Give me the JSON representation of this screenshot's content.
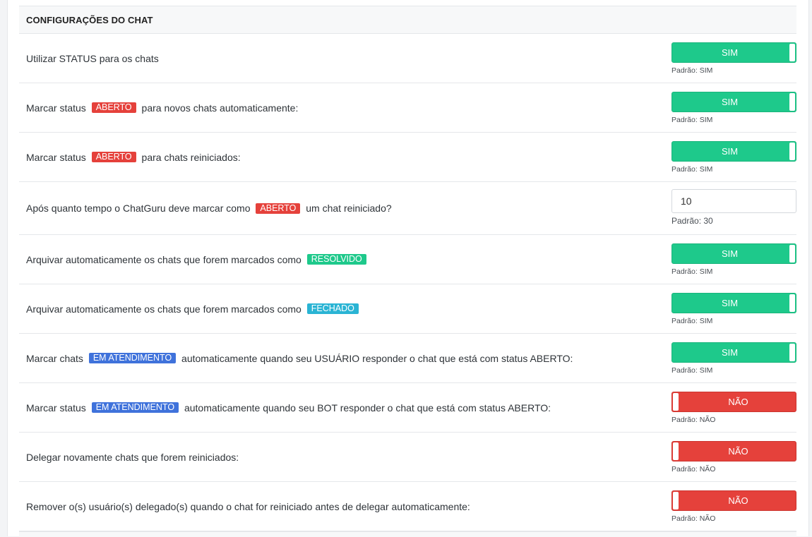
{
  "section": {
    "title": "CONFIGURAÇÕES DO CHAT"
  },
  "colors": {
    "on": "#1ec98b",
    "off": "#e5413b",
    "badge_red": "#e5413b",
    "badge_green": "#1ec98b",
    "badge_cyan": "#2ab4d4",
    "badge_blue": "#3f72db"
  },
  "rows": [
    {
      "parts": [
        "Utilizar STATUS para os chats"
      ],
      "control": {
        "type": "toggle",
        "state": "on",
        "label": "SIM",
        "default": "Padrão: SIM"
      }
    },
    {
      "parts": [
        "Marcar status ",
        "ABERTO",
        " para novos chats automaticamente:"
      ],
      "badge": {
        "text": "ABERTO",
        "color": "red"
      },
      "control": {
        "type": "toggle",
        "state": "on",
        "label": "SIM",
        "default": "Padrão: SIM"
      }
    },
    {
      "parts": [
        "Marcar status ",
        "ABERTO",
        " para chats reiniciados:"
      ],
      "badge": {
        "text": "ABERTO",
        "color": "red"
      },
      "control": {
        "type": "toggle",
        "state": "on",
        "label": "SIM",
        "default": "Padrão: SIM"
      }
    },
    {
      "parts": [
        "Após quanto tempo o ChatGuru deve marcar como ",
        "ABERTO",
        " um chat reiniciado?"
      ],
      "badge": {
        "text": "ABERTO",
        "color": "red"
      },
      "control": {
        "type": "input",
        "value": "10",
        "default": "Padrão: 30"
      }
    },
    {
      "parts": [
        "Arquivar automaticamente os chats que forem marcados como ",
        "RESOLVIDO",
        ""
      ],
      "badge": {
        "text": "RESOLVIDO",
        "color": "green"
      },
      "control": {
        "type": "toggle",
        "state": "on",
        "label": "SIM",
        "default": "Padrão: SIM"
      }
    },
    {
      "parts": [
        "Arquivar automaticamente os chats que forem marcados como ",
        "FECHADO",
        ""
      ],
      "badge": {
        "text": "FECHADO",
        "color": "cyan"
      },
      "control": {
        "type": "toggle",
        "state": "on",
        "label": "SIM",
        "default": "Padrão: SIM"
      }
    },
    {
      "parts": [
        "Marcar chats ",
        "EM ATENDIMENTO",
        " automaticamente quando seu USUÁRIO responder o chat que está com status ABERTO:"
      ],
      "badge": {
        "text": "EM ATENDIMENTO",
        "color": "blue"
      },
      "control": {
        "type": "toggle",
        "state": "on",
        "label": "SIM",
        "default": "Padrão: SIM"
      }
    },
    {
      "parts": [
        "Marcar status ",
        "EM ATENDIMENTO",
        " automaticamente quando seu BOT responder o chat que está com status ABERTO:"
      ],
      "badge": {
        "text": "EM ATENDIMENTO",
        "color": "blue"
      },
      "control": {
        "type": "toggle",
        "state": "off",
        "label": "NÃO",
        "default": "Padrão: NÃO"
      }
    },
    {
      "parts": [
        "Delegar novamente chats que forem reiniciados:"
      ],
      "control": {
        "type": "toggle",
        "state": "off",
        "label": "NÃO",
        "default": "Padrão: NÃO"
      }
    },
    {
      "parts": [
        "Remover o(s) usuário(s) delegado(s) quando o chat for reiniciado antes de delegar automaticamente:"
      ],
      "control": {
        "type": "toggle",
        "state": "off",
        "label": "NÃO",
        "default": "Padrão: NÃO"
      }
    }
  ]
}
